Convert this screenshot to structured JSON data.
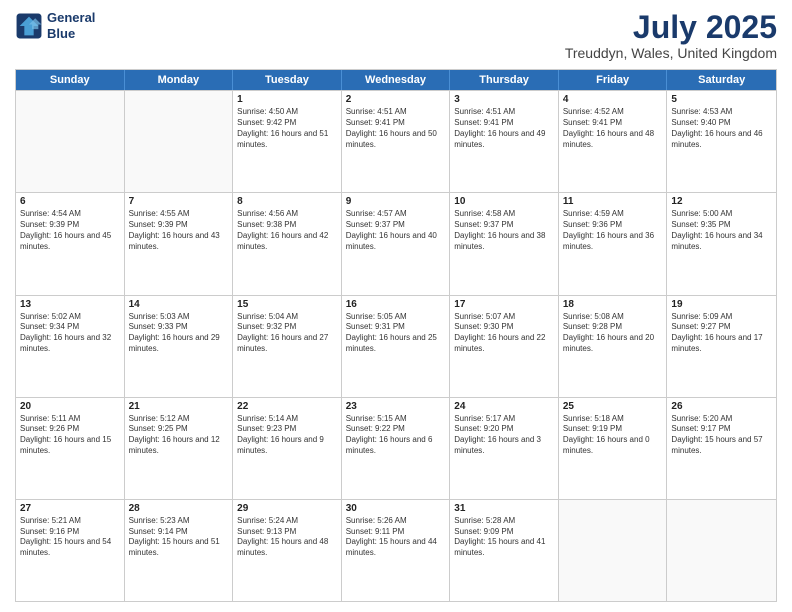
{
  "header": {
    "logo_line1": "General",
    "logo_line2": "Blue",
    "main_title": "July 2025",
    "subtitle": "Treuddyn, Wales, United Kingdom"
  },
  "weekdays": [
    "Sunday",
    "Monday",
    "Tuesday",
    "Wednesday",
    "Thursday",
    "Friday",
    "Saturday"
  ],
  "weeks": [
    [
      {
        "day": "",
        "empty": true
      },
      {
        "day": "",
        "empty": true
      },
      {
        "day": "1",
        "sunrise": "Sunrise: 4:50 AM",
        "sunset": "Sunset: 9:42 PM",
        "daylight": "Daylight: 16 hours and 51 minutes."
      },
      {
        "day": "2",
        "sunrise": "Sunrise: 4:51 AM",
        "sunset": "Sunset: 9:41 PM",
        "daylight": "Daylight: 16 hours and 50 minutes."
      },
      {
        "day": "3",
        "sunrise": "Sunrise: 4:51 AM",
        "sunset": "Sunset: 9:41 PM",
        "daylight": "Daylight: 16 hours and 49 minutes."
      },
      {
        "day": "4",
        "sunrise": "Sunrise: 4:52 AM",
        "sunset": "Sunset: 9:41 PM",
        "daylight": "Daylight: 16 hours and 48 minutes."
      },
      {
        "day": "5",
        "sunrise": "Sunrise: 4:53 AM",
        "sunset": "Sunset: 9:40 PM",
        "daylight": "Daylight: 16 hours and 46 minutes."
      }
    ],
    [
      {
        "day": "6",
        "sunrise": "Sunrise: 4:54 AM",
        "sunset": "Sunset: 9:39 PM",
        "daylight": "Daylight: 16 hours and 45 minutes."
      },
      {
        "day": "7",
        "sunrise": "Sunrise: 4:55 AM",
        "sunset": "Sunset: 9:39 PM",
        "daylight": "Daylight: 16 hours and 43 minutes."
      },
      {
        "day": "8",
        "sunrise": "Sunrise: 4:56 AM",
        "sunset": "Sunset: 9:38 PM",
        "daylight": "Daylight: 16 hours and 42 minutes."
      },
      {
        "day": "9",
        "sunrise": "Sunrise: 4:57 AM",
        "sunset": "Sunset: 9:37 PM",
        "daylight": "Daylight: 16 hours and 40 minutes."
      },
      {
        "day": "10",
        "sunrise": "Sunrise: 4:58 AM",
        "sunset": "Sunset: 9:37 PM",
        "daylight": "Daylight: 16 hours and 38 minutes."
      },
      {
        "day": "11",
        "sunrise": "Sunrise: 4:59 AM",
        "sunset": "Sunset: 9:36 PM",
        "daylight": "Daylight: 16 hours and 36 minutes."
      },
      {
        "day": "12",
        "sunrise": "Sunrise: 5:00 AM",
        "sunset": "Sunset: 9:35 PM",
        "daylight": "Daylight: 16 hours and 34 minutes."
      }
    ],
    [
      {
        "day": "13",
        "sunrise": "Sunrise: 5:02 AM",
        "sunset": "Sunset: 9:34 PM",
        "daylight": "Daylight: 16 hours and 32 minutes."
      },
      {
        "day": "14",
        "sunrise": "Sunrise: 5:03 AM",
        "sunset": "Sunset: 9:33 PM",
        "daylight": "Daylight: 16 hours and 29 minutes."
      },
      {
        "day": "15",
        "sunrise": "Sunrise: 5:04 AM",
        "sunset": "Sunset: 9:32 PM",
        "daylight": "Daylight: 16 hours and 27 minutes."
      },
      {
        "day": "16",
        "sunrise": "Sunrise: 5:05 AM",
        "sunset": "Sunset: 9:31 PM",
        "daylight": "Daylight: 16 hours and 25 minutes."
      },
      {
        "day": "17",
        "sunrise": "Sunrise: 5:07 AM",
        "sunset": "Sunset: 9:30 PM",
        "daylight": "Daylight: 16 hours and 22 minutes."
      },
      {
        "day": "18",
        "sunrise": "Sunrise: 5:08 AM",
        "sunset": "Sunset: 9:28 PM",
        "daylight": "Daylight: 16 hours and 20 minutes."
      },
      {
        "day": "19",
        "sunrise": "Sunrise: 5:09 AM",
        "sunset": "Sunset: 9:27 PM",
        "daylight": "Daylight: 16 hours and 17 minutes."
      }
    ],
    [
      {
        "day": "20",
        "sunrise": "Sunrise: 5:11 AM",
        "sunset": "Sunset: 9:26 PM",
        "daylight": "Daylight: 16 hours and 15 minutes."
      },
      {
        "day": "21",
        "sunrise": "Sunrise: 5:12 AM",
        "sunset": "Sunset: 9:25 PM",
        "daylight": "Daylight: 16 hours and 12 minutes."
      },
      {
        "day": "22",
        "sunrise": "Sunrise: 5:14 AM",
        "sunset": "Sunset: 9:23 PM",
        "daylight": "Daylight: 16 hours and 9 minutes."
      },
      {
        "day": "23",
        "sunrise": "Sunrise: 5:15 AM",
        "sunset": "Sunset: 9:22 PM",
        "daylight": "Daylight: 16 hours and 6 minutes."
      },
      {
        "day": "24",
        "sunrise": "Sunrise: 5:17 AM",
        "sunset": "Sunset: 9:20 PM",
        "daylight": "Daylight: 16 hours and 3 minutes."
      },
      {
        "day": "25",
        "sunrise": "Sunrise: 5:18 AM",
        "sunset": "Sunset: 9:19 PM",
        "daylight": "Daylight: 16 hours and 0 minutes."
      },
      {
        "day": "26",
        "sunrise": "Sunrise: 5:20 AM",
        "sunset": "Sunset: 9:17 PM",
        "daylight": "Daylight: 15 hours and 57 minutes."
      }
    ],
    [
      {
        "day": "27",
        "sunrise": "Sunrise: 5:21 AM",
        "sunset": "Sunset: 9:16 PM",
        "daylight": "Daylight: 15 hours and 54 minutes."
      },
      {
        "day": "28",
        "sunrise": "Sunrise: 5:23 AM",
        "sunset": "Sunset: 9:14 PM",
        "daylight": "Daylight: 15 hours and 51 minutes."
      },
      {
        "day": "29",
        "sunrise": "Sunrise: 5:24 AM",
        "sunset": "Sunset: 9:13 PM",
        "daylight": "Daylight: 15 hours and 48 minutes."
      },
      {
        "day": "30",
        "sunrise": "Sunrise: 5:26 AM",
        "sunset": "Sunset: 9:11 PM",
        "daylight": "Daylight: 15 hours and 44 minutes."
      },
      {
        "day": "31",
        "sunrise": "Sunrise: 5:28 AM",
        "sunset": "Sunset: 9:09 PM",
        "daylight": "Daylight: 15 hours and 41 minutes."
      },
      {
        "day": "",
        "empty": true
      },
      {
        "day": "",
        "empty": true
      }
    ]
  ]
}
